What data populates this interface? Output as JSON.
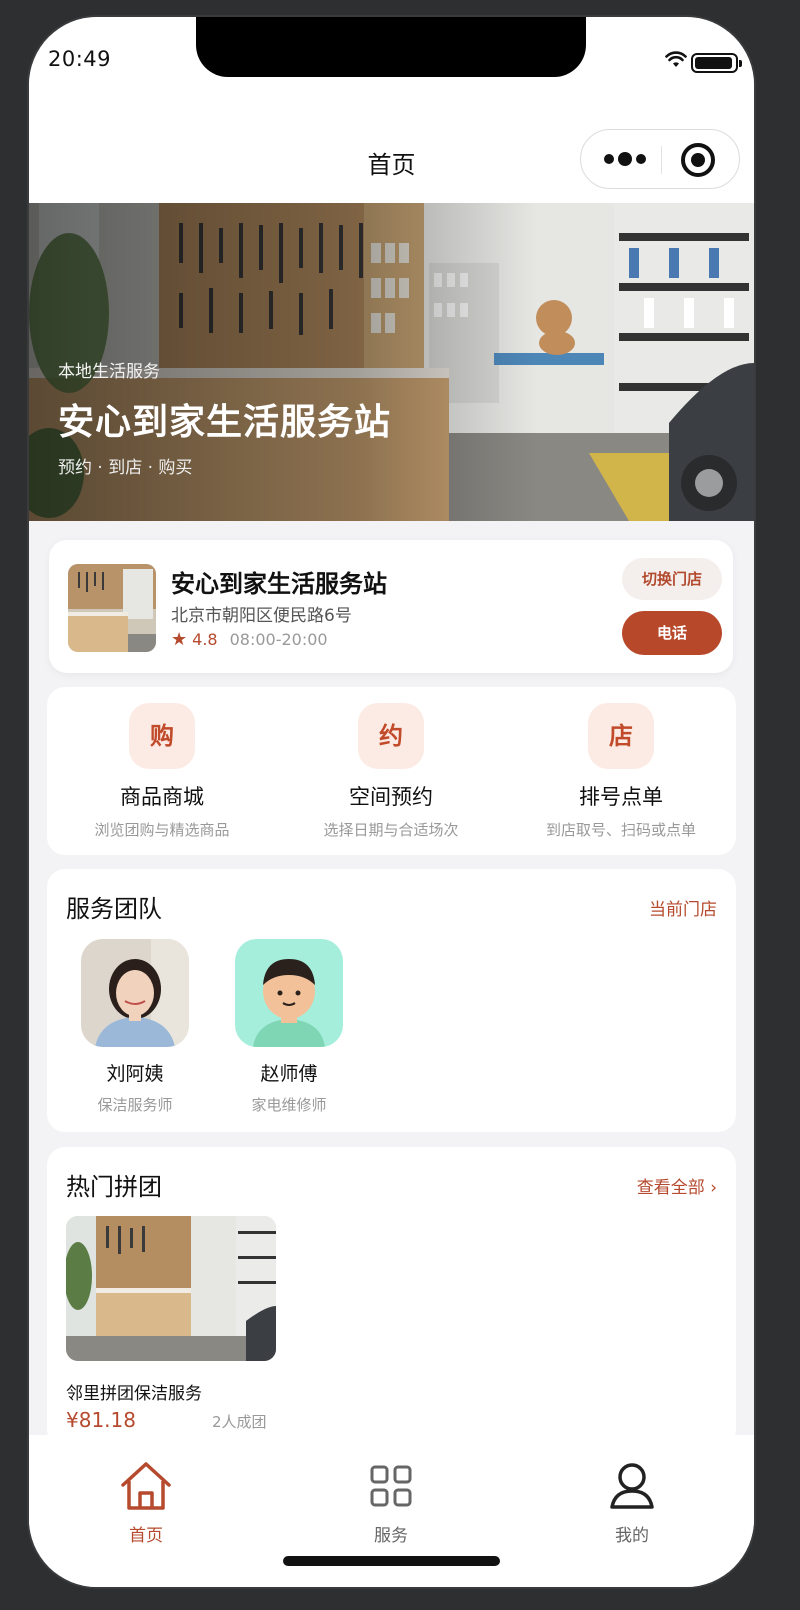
{
  "status_bar": {
    "time": "20:49"
  },
  "nav": {
    "title": "首页"
  },
  "hero": {
    "eyebrow": "本地生活服务",
    "title": "安心到家生活服务站",
    "tags": "预约 · 到店 · 购买"
  },
  "store": {
    "name": "安心到家生活服务站",
    "address": "北京市朝阳区便民路6号",
    "rating": "4.8",
    "hours": "08:00-20:00",
    "switch_label": "切换门店",
    "call_label": "电话"
  },
  "actions": [
    {
      "icon_char": "购",
      "title": "商品商城",
      "subtitle": "浏览团购与精选商品"
    },
    {
      "icon_char": "约",
      "title": "空间预约",
      "subtitle": "选择日期与合适场次"
    },
    {
      "icon_char": "店",
      "title": "排号点单",
      "subtitle": "到店取号、扫码或点单"
    }
  ],
  "team": {
    "title": "服务团队",
    "link": "当前门店",
    "members": [
      {
        "name": "刘阿姨",
        "role": "保洁服务师"
      },
      {
        "name": "赵师傅",
        "role": "家电维修师"
      }
    ]
  },
  "group_buy": {
    "title": "热门拼团",
    "link": "查看全部 ›",
    "items": [
      {
        "name": "邻里拼团保洁服务",
        "price": "¥81.18",
        "min_people": "2人成团"
      }
    ]
  },
  "tabbar": [
    {
      "label": "首页",
      "icon": "home-icon",
      "active": true
    },
    {
      "label": "服务",
      "icon": "grid-icon",
      "active": false
    },
    {
      "label": "我的",
      "icon": "user-icon",
      "active": false
    }
  ],
  "colors": {
    "accent": "#b7482a",
    "accent_light": "#fcebe4",
    "background": "#f3f3f5"
  }
}
